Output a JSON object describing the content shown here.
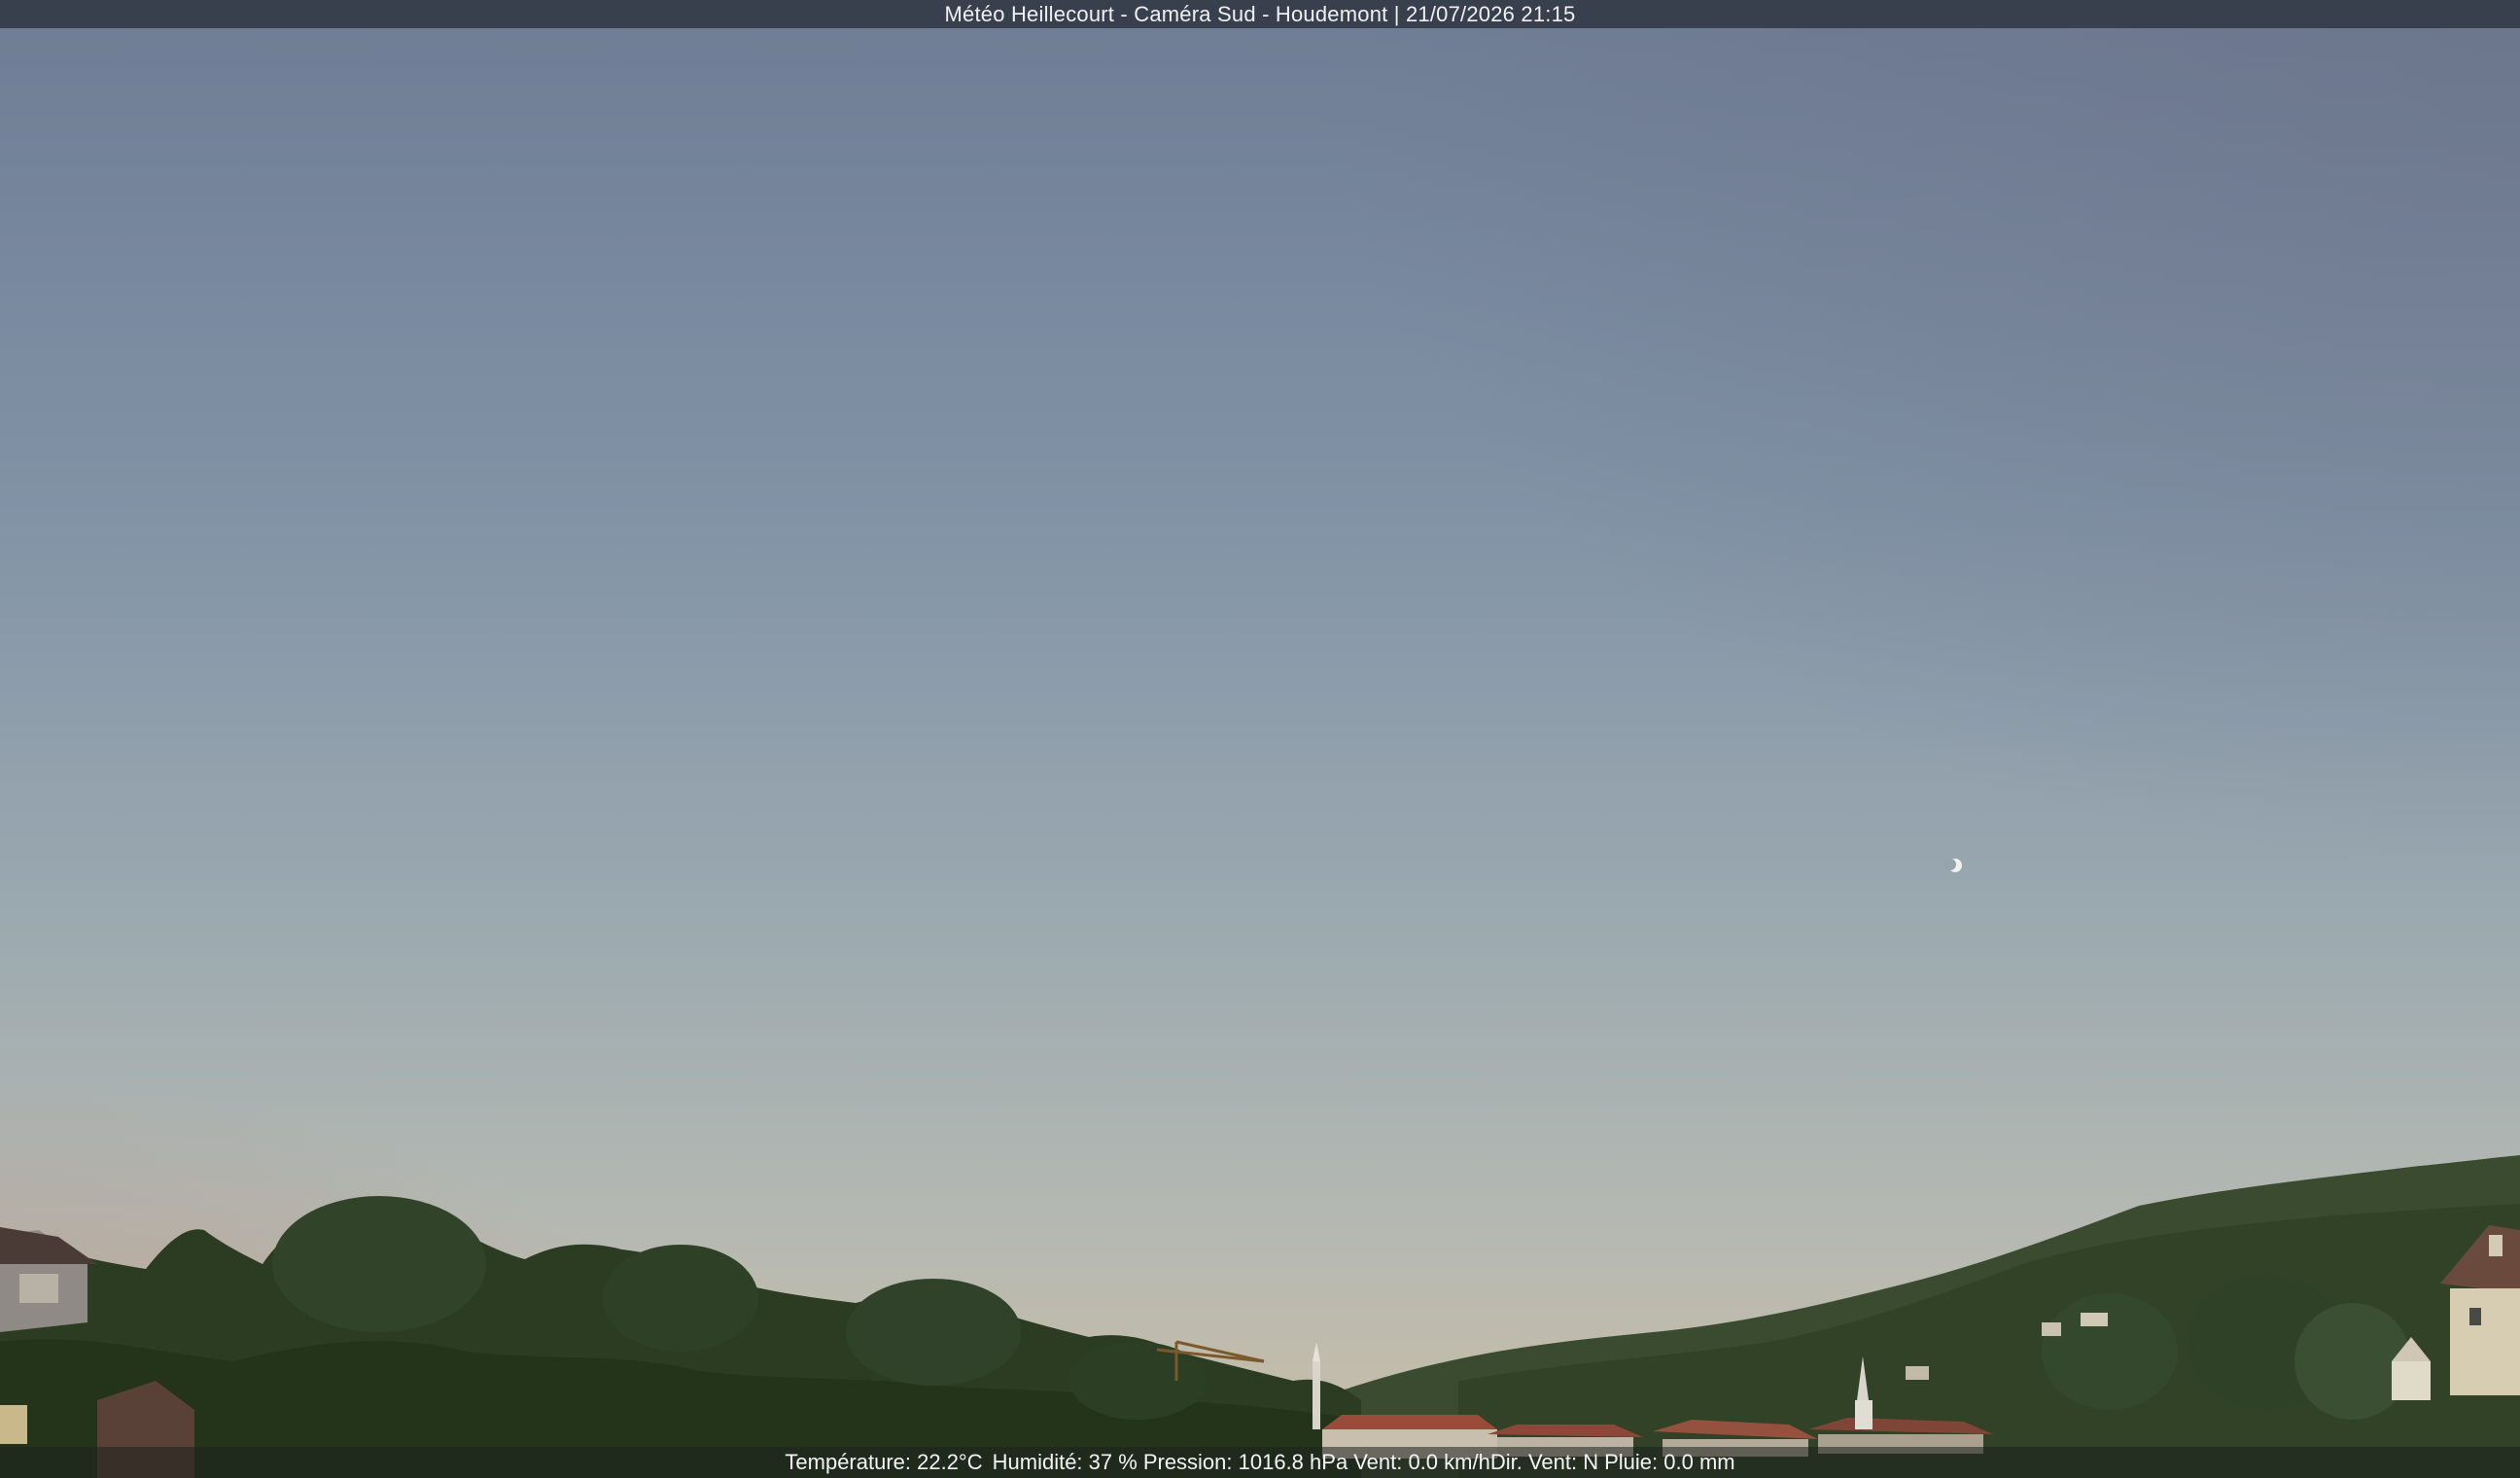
{
  "caption": {
    "title": "Météo Heillecourt - Caméra Sud - Houdemont | 21/07/2026 21:15"
  },
  "weather": {
    "temperature": "Température: 22.2°C",
    "humidity": "Humidité: 37 %",
    "pressure": "Pression: 1016.8 hPa",
    "wind_speed": "Vent: 0.0 km/h",
    "wind_direction": "Dir. Vent: N",
    "rain": "Pluie: 0.0 mm"
  },
  "colors": {
    "sky_top": "#6f7e96",
    "sky_middle": "#9aa9b0",
    "sky_horizon": "#c9bfa9",
    "sky_horizon_left": "#b09a92",
    "hills": "#35472b",
    "trees": "#2c3d22",
    "roofs": "#8a4a3a",
    "moon": "#f0f0ea"
  }
}
